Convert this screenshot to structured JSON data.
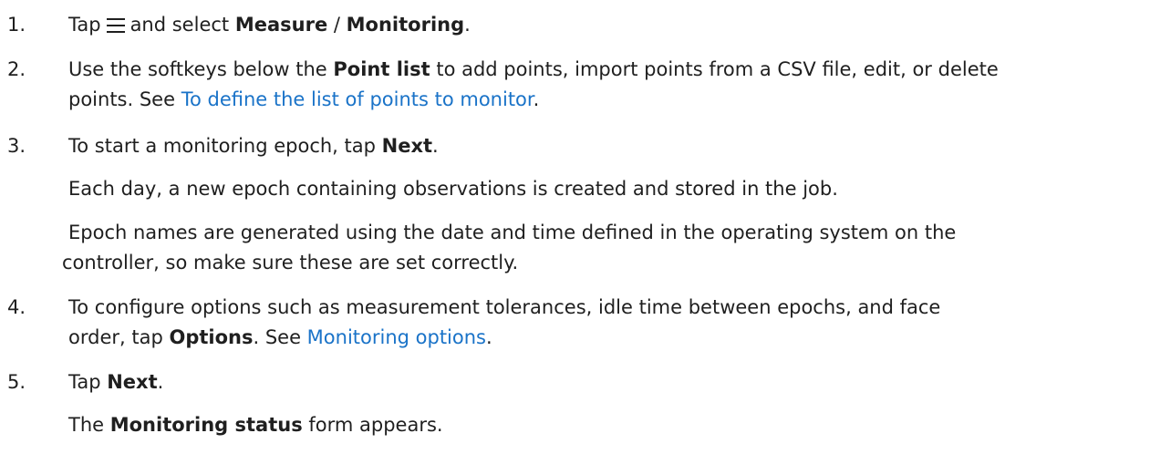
{
  "steps": [
    {
      "num": "1.",
      "pre": "Tap",
      "mid": "and select",
      "b1": "Measure",
      "sep": " / ",
      "b2": "Monitoring",
      "end": "."
    },
    {
      "num": "2.",
      "pre": "Use the softkeys below the ",
      "bold": "Point list",
      "post": " to add points, import points from a CSV file, edit, or delete",
      "line2_pre": "points. See ",
      "link": "To define the list of points to monitor",
      "end": "."
    },
    {
      "num": "3.",
      "pre": "To start a monitoring epoch, tap ",
      "bold": "Next",
      "end": ".",
      "para1": "Each day, a new epoch containing observations is created and stored in the job.",
      "para2_line1": "Epoch names are generated using the date and time defined in the operating system on the",
      "para2_line2": "controller, so make sure these are set correctly."
    },
    {
      "num": "4.",
      "line1": "To configure options such as measurement tolerances, idle time between epochs, and face",
      "line2_pre": "order, tap ",
      "bold": "Options",
      "mid": ". See ",
      "link": "Monitoring options",
      "end": "."
    },
    {
      "num": "5.",
      "pre": "Tap ",
      "bold": "Next",
      "end": ".",
      "para_pre": "The ",
      "para_bold": "Monitoring status",
      "para_post": " form appears."
    }
  ],
  "icons": {
    "menu": "hamburger-menu-icon"
  },
  "colors": {
    "text": "#1f1f1f",
    "link": "#1a73c8"
  }
}
